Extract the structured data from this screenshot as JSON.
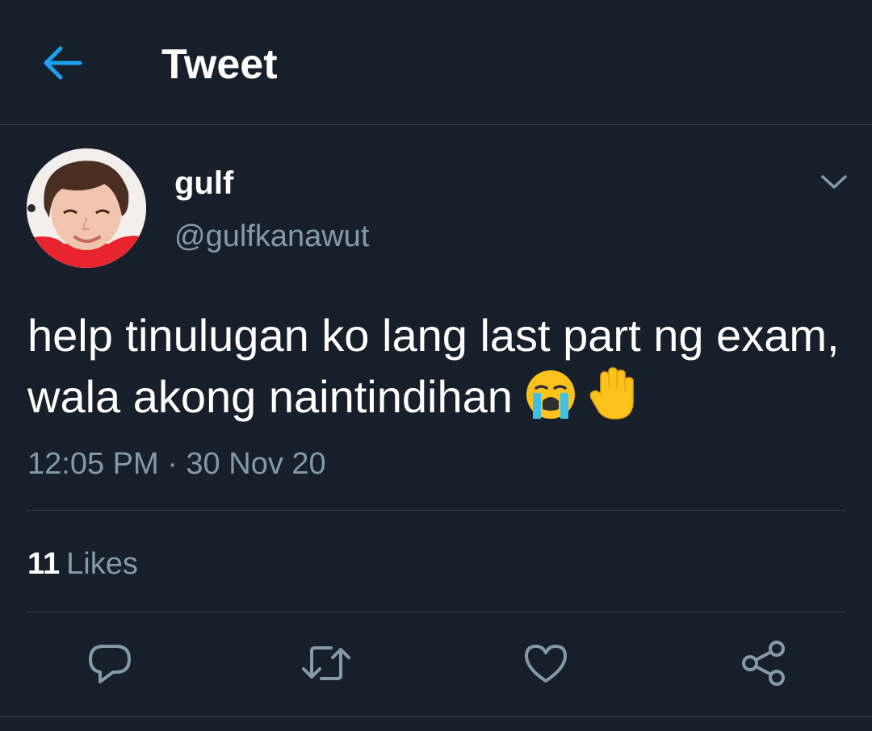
{
  "header": {
    "title": "Tweet",
    "back_icon": "arrow-left-icon",
    "accent_color": "#1da1f2"
  },
  "tweet": {
    "author": {
      "display_name": "gulf",
      "handle": "@gulfkanawut"
    },
    "text": "help tinulugan ko lang last part ng exam, wala akong naintindihan",
    "emojis": [
      "loudly-crying-face-emoji",
      "raised-hand-emoji"
    ],
    "timestamp": "12:05 PM · 30 Nov 20",
    "likes": {
      "count": "11",
      "label": "Likes"
    }
  },
  "actions": [
    {
      "name": "reply",
      "icon": "reply-icon"
    },
    {
      "name": "retweet",
      "icon": "retweet-icon"
    },
    {
      "name": "like",
      "icon": "heart-icon"
    },
    {
      "name": "share",
      "icon": "share-icon"
    }
  ],
  "colors": {
    "background": "#17202a",
    "text_primary": "#ffffff",
    "text_secondary": "#8899a6",
    "divider": "#38444d"
  }
}
